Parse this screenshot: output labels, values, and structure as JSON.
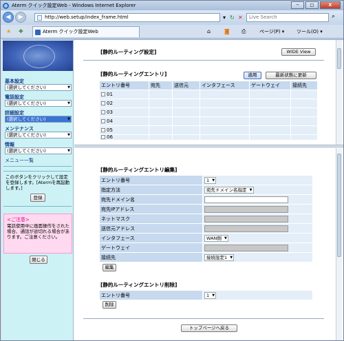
{
  "window": {
    "title": "Aterm クイック設定Web - Windows Internet Explorer",
    "controls": {
      "minimize": "─",
      "maximize": "□",
      "close": "X"
    }
  },
  "address_bar": {
    "back_glyph": "◀",
    "forward_glyph": "▶",
    "url": "http://web.setup/index_frame.html",
    "search_placeholder": "Live Search"
  },
  "tab": {
    "label": "Aterm クイック設定Web"
  },
  "toolbar": {
    "page_label": "ページ(P)",
    "tools_label": "ツール(O)"
  },
  "sidebar": {
    "groups": [
      {
        "label": "基本設定",
        "select": "(選択してください)",
        "highlighted": false
      },
      {
        "label": "電話設定",
        "select": "(選択してください)",
        "highlighted": false
      },
      {
        "label": "詳細設定",
        "select": "(選択してください)",
        "highlighted": true
      },
      {
        "label": "メンテナンス",
        "select": "(選択してください)",
        "highlighted": false
      },
      {
        "label": "情報",
        "select": "(選択してください)",
        "highlighted": false
      }
    ],
    "menu_list": "メニュー一覧",
    "register_note": "このボタンをクリックして設定を登録します。[Atermを再起動します。]",
    "register_button": "登録",
    "caution_title": "<ご注意>",
    "caution_text": "電話使用中に画面操作をされた場合、通話が途切れる場合があります。ご注意ください。",
    "close_button": "閉じる"
  },
  "static_routing": {
    "title": "[静的ルーティング設定]",
    "wide_view_button": "WIDE View",
    "entry_title": "[静的ルーティングエントリ]",
    "apply_button": "適用",
    "refresh_button": "最新状態に更新",
    "columns": [
      "エントリ番号",
      "宛先",
      "送信元",
      "インタフェース",
      "ゲートウェイ",
      "接続先"
    ],
    "rows": [
      "01",
      "02",
      "03",
      "04",
      "05",
      "06"
    ]
  },
  "edit": {
    "title": "[静的ルーティングエントリ編集]",
    "fields": [
      {
        "label": "エントリ番号",
        "kind": "select",
        "value": "1"
      },
      {
        "label": "指定方法",
        "kind": "select",
        "value": "宛先ドメイン名指定"
      },
      {
        "label": "宛先ドメイン名",
        "kind": "input-white",
        "value": ""
      },
      {
        "label": "宛先IPアドレス",
        "kind": "input-gray",
        "value": ""
      },
      {
        "label": "ネットマスク",
        "kind": "input-gray",
        "value": ""
      },
      {
        "label": "送信元アドレス",
        "kind": "input-gray",
        "value": ""
      },
      {
        "label": "インタフェース",
        "kind": "select",
        "value": "WAN側"
      },
      {
        "label": "ゲートウェイ",
        "kind": "input-gray",
        "value": ""
      },
      {
        "label": "接続先",
        "kind": "select",
        "value": "接続設定1"
      }
    ],
    "edit_button": "編集"
  },
  "delete": {
    "title": "[静的ルーティングエントリ削除]",
    "field_label": "エントリ番号",
    "field_value": "1",
    "delete_button": "削除"
  },
  "back_to_top_button": "トップページへ戻る"
}
